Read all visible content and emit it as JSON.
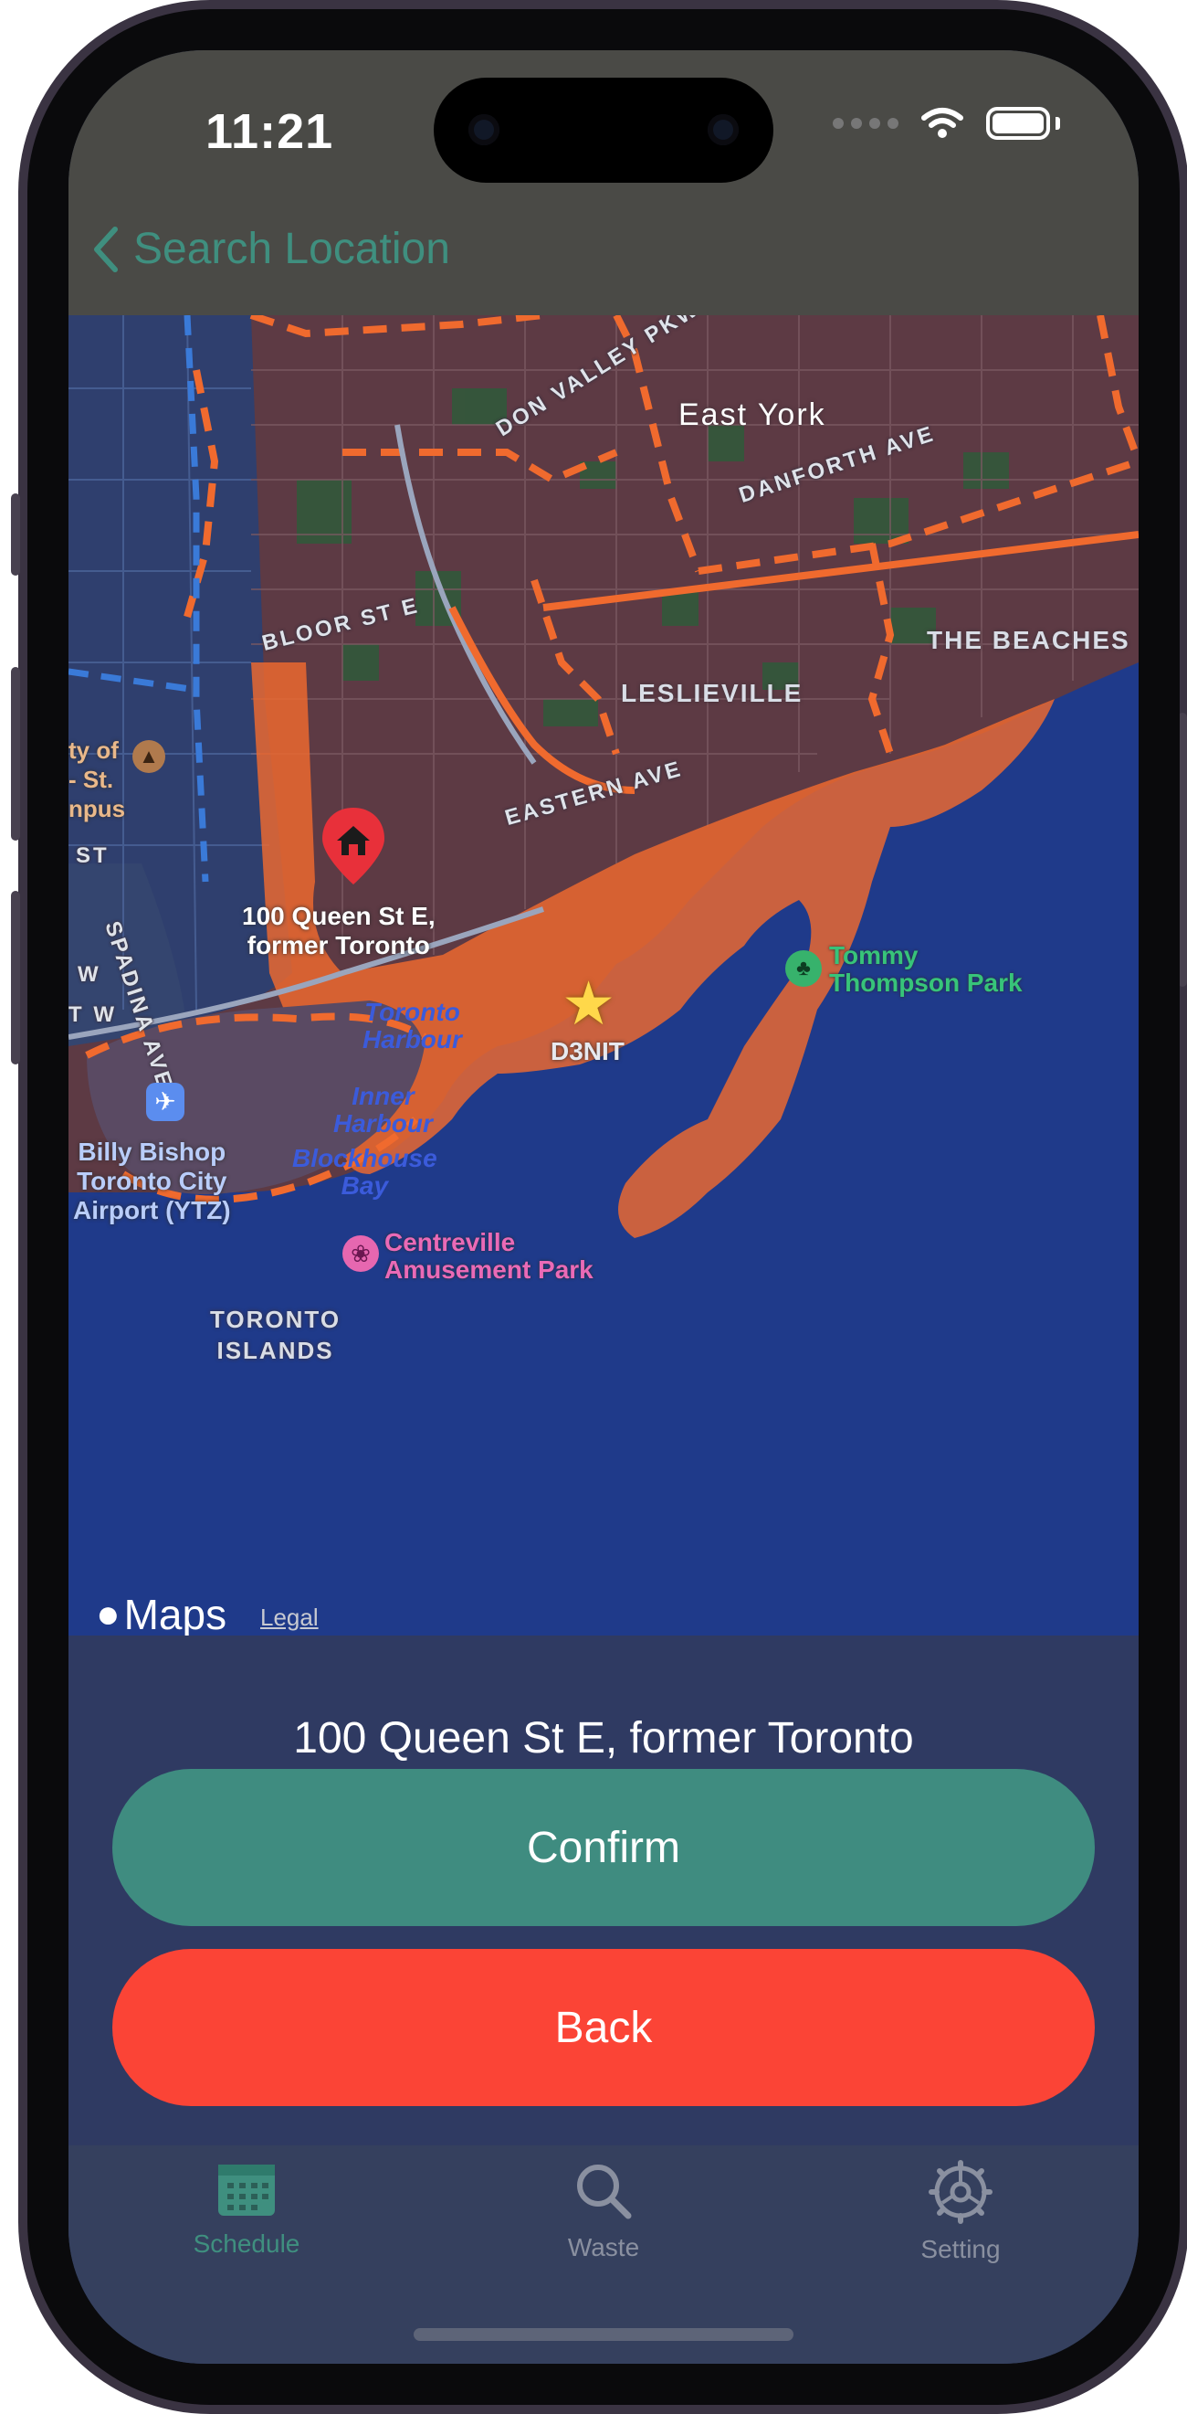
{
  "status_bar": {
    "time": "11:21"
  },
  "nav": {
    "back_label": "Search Location"
  },
  "map": {
    "labels": {
      "don_valley": "DON VALLEY PKWY",
      "east_york": "East York",
      "danforth": "DANFORTH AVE",
      "bloor": "BLOOR ST E",
      "beaches": "THE BEACHES",
      "leslieville": "LESLIEVILLE",
      "eastern": "EASTERN AVE",
      "spadina": "SPADINA AVE",
      "campus": "ty of\n- St.\nnpus",
      "st": "ST",
      "w1": "W",
      "w2": "T W",
      "harbour": "Toronto\nHarbour",
      "inner_harbour": "Inner\nHarbour",
      "blockhouse": "Blockhouse\nBay",
      "islands": "TORONTO\nISLANDS",
      "airport": "Billy Bishop\nToronto City\nAirport (YTZ)",
      "centreville": "Centreville\nAmusement Park",
      "tommy": "Tommy\nThompson Park",
      "pin_address": "100 Queen St E,\nformer Toronto",
      "star_label": "D3NIT"
    },
    "attribution": "Maps",
    "legal": "Legal"
  },
  "panel": {
    "address": "100 Queen St E, former Toronto",
    "confirm": "Confirm",
    "back": "Back"
  },
  "tabs": [
    {
      "label": "Schedule",
      "icon": "calendar-icon",
      "active": true
    },
    {
      "label": "Waste",
      "icon": "search-icon",
      "active": false
    },
    {
      "label": "Setting",
      "icon": "gear-icon",
      "active": false
    }
  ],
  "colors": {
    "accent": "#3f8c80",
    "danger": "#fb4436",
    "tab_active": "#3f8f7f",
    "tab_inactive": "#8a90a0",
    "map_water": "#1f3a8a",
    "zone_orange": "#ff6a2b"
  }
}
